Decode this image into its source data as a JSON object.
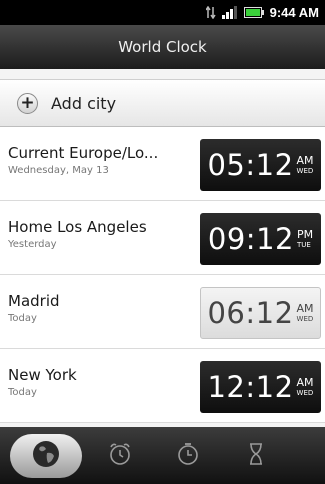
{
  "status_bar": {
    "time": "9:44 AM"
  },
  "title": "World Clock",
  "add_city": {
    "label": "Add city"
  },
  "cities": [
    {
      "name": "Current  Europe/Lo...",
      "sub": "Wednesday, May 13",
      "time": "05:12",
      "ampm": "AM",
      "day": "WED",
      "style": "dark"
    },
    {
      "name": "Home  Los Angeles",
      "sub": "Yesterday",
      "time": "09:12",
      "ampm": "PM",
      "day": "TUE",
      "style": "dark"
    },
    {
      "name": "Madrid",
      "sub": "Today",
      "time": "06:12",
      "ampm": "AM",
      "day": "WED",
      "style": "light"
    },
    {
      "name": "New York",
      "sub": "Today",
      "time": "12:12",
      "ampm": "AM",
      "day": "WED",
      "style": "dark"
    }
  ],
  "tabs": [
    {
      "icon": "globe-icon",
      "active": true
    },
    {
      "icon": "alarm-clock-icon",
      "active": false
    },
    {
      "icon": "stopwatch-icon",
      "active": false
    },
    {
      "icon": "timer-icon",
      "active": false
    }
  ]
}
